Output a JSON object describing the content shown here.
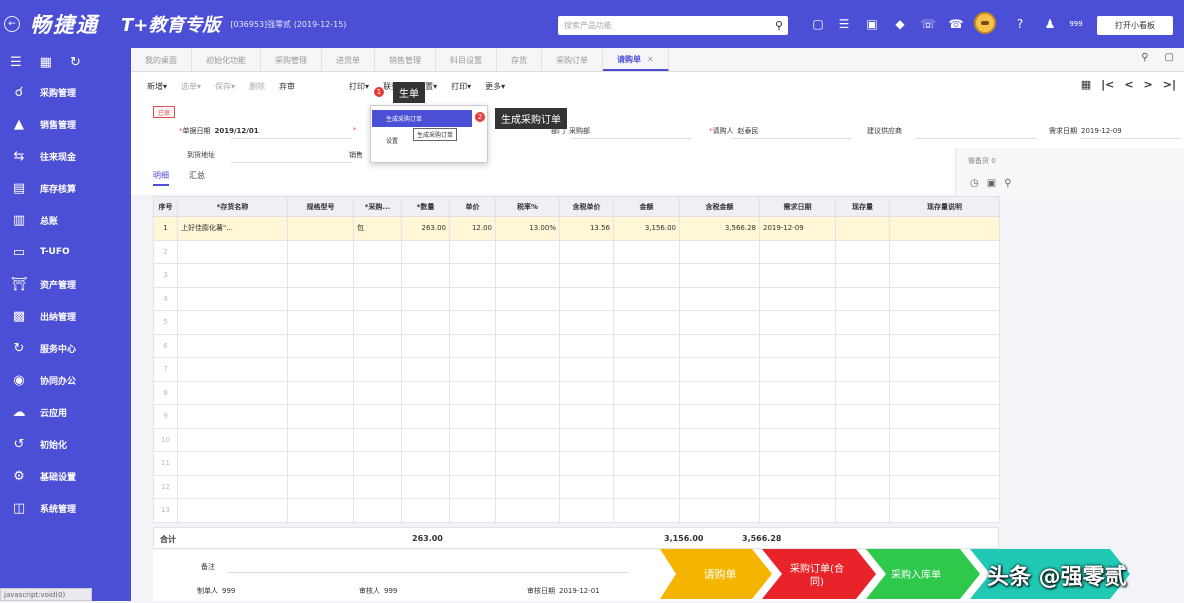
{
  "topbar": {
    "brand": "畅捷通",
    "product": "T+教育专版",
    "account": "[036953]强零贰 (2019-12-15)",
    "search_placeholder": "搜索产品功能",
    "notify_count": "999",
    "open_board": "打开小看板"
  },
  "sidebar": {
    "items": [
      {
        "label": "采购管理",
        "icon": "cart-icon"
      },
      {
        "label": "销售管理",
        "icon": "sales-icon"
      },
      {
        "label": "往来现金",
        "icon": "cash-icon"
      },
      {
        "label": "库存核算",
        "icon": "inventory-icon"
      },
      {
        "label": "总账",
        "icon": "ledger-icon"
      },
      {
        "label": "T-UFO",
        "icon": "report-icon"
      },
      {
        "label": "资产管理",
        "icon": "asset-icon"
      },
      {
        "label": "出纳管理",
        "icon": "cashier-icon"
      },
      {
        "label": "服务中心",
        "icon": "service-icon"
      },
      {
        "label": "协同办公",
        "icon": "office-icon"
      },
      {
        "label": "云应用",
        "icon": "cloud-icon"
      },
      {
        "label": "初始化",
        "icon": "init-icon"
      },
      {
        "label": "基础设置",
        "icon": "settings-icon"
      },
      {
        "label": "系统管理",
        "icon": "system-icon"
      }
    ],
    "status_url": "javascript:void(0)"
  },
  "tabs": [
    {
      "label": "我的桌面"
    },
    {
      "label": "初始化功能"
    },
    {
      "label": "采购管理"
    },
    {
      "label": "进货单"
    },
    {
      "label": "销售管理"
    },
    {
      "label": "科目设置"
    },
    {
      "label": "存货"
    },
    {
      "label": "采购订单"
    },
    {
      "label": "请购单",
      "active": true
    }
  ],
  "toolbar": {
    "items": [
      {
        "label": "新增▾",
        "dim": false
      },
      {
        "label": "选单▾",
        "dim": true
      },
      {
        "label": "保存▾",
        "dim": true
      },
      {
        "label": "删除",
        "dim": true
      },
      {
        "label": "弃审",
        "dim": false
      },
      {
        "label": "生单▾",
        "dim": false
      },
      {
        "label": "打印▾",
        "dim": false
      },
      {
        "label": "联查▾",
        "dim": false
      },
      {
        "label": "设置▾",
        "dim": false
      },
      {
        "label": "打印▾",
        "dim": false
      },
      {
        "label": "更多▾",
        "dim": false
      }
    ]
  },
  "form": {
    "badge": "已审",
    "date_label": "单据日期",
    "date_value": "2019/12/01",
    "dept_label": "部门",
    "dept_value": "采购部",
    "requester_label": "请购人",
    "requester_value": "赵泰民",
    "supplier_label": "建议供应商",
    "need_date_label": "需求日期",
    "need_date_value": "2019-12-09",
    "address_label": "到货地址",
    "sales_label": "销售",
    "detail_tab": "明细",
    "summary_tab": "汇总",
    "side_label": "做备货 0"
  },
  "menu": {
    "callout1": "生单",
    "callout2": "生成采购订单",
    "item1": "生成采购订单",
    "item2": "设置",
    "tooltip": "生成采购订单",
    "step1": "1",
    "step2": "2"
  },
  "table": {
    "headers": [
      "序号",
      "*存货名称",
      "规格型号",
      "*采购...",
      "*数量",
      "单价",
      "税率%",
      "含税单价",
      "金额",
      "含税金额",
      "需求日期",
      "现存量",
      "现存量说明"
    ],
    "rows": [
      [
        "1",
        "上好佳膨化薯\"...",
        "",
        "包",
        "263.00",
        "12.00",
        "13.00%",
        "13.56",
        "3,156.00",
        "3,566.28",
        "2019-12-09",
        "",
        ""
      ],
      [
        "2",
        "",
        "",
        "",
        "",
        "",
        "",
        "",
        "",
        "",
        "",
        "",
        ""
      ],
      [
        "3",
        "",
        "",
        "",
        "",
        "",
        "",
        "",
        "",
        "",
        "",
        "",
        ""
      ],
      [
        "4",
        "",
        "",
        "",
        "",
        "",
        "",
        "",
        "",
        "",
        "",
        "",
        ""
      ],
      [
        "5",
        "",
        "",
        "",
        "",
        "",
        "",
        "",
        "",
        "",
        "",
        "",
        ""
      ],
      [
        "6",
        "",
        "",
        "",
        "",
        "",
        "",
        "",
        "",
        "",
        "",
        "",
        ""
      ],
      [
        "7",
        "",
        "",
        "",
        "",
        "",
        "",
        "",
        "",
        "",
        "",
        "",
        ""
      ],
      [
        "8",
        "",
        "",
        "",
        "",
        "",
        "",
        "",
        "",
        "",
        "",
        "",
        ""
      ],
      [
        "9",
        "",
        "",
        "",
        "",
        "",
        "",
        "",
        "",
        "",
        "",
        "",
        ""
      ],
      [
        "10",
        "",
        "",
        "",
        "",
        "",
        "",
        "",
        "",
        "",
        "",
        "",
        ""
      ],
      [
        "11",
        "",
        "",
        "",
        "",
        "",
        "",
        "",
        "",
        "",
        "",
        "",
        ""
      ],
      [
        "12",
        "",
        "",
        "",
        "",
        "",
        "",
        "",
        "",
        "",
        "",
        "",
        ""
      ],
      [
        "13",
        "",
        "",
        "",
        "",
        "",
        "",
        "",
        "",
        "",
        "",
        "",
        ""
      ]
    ],
    "total_label": "合计",
    "total_qty": "263.00",
    "total_amount": "3,156.00",
    "total_tax_amount": "3,566.28"
  },
  "footer": {
    "note_label": "备注",
    "maker_label": "制单人",
    "maker_value": "999",
    "auditor_label": "审核人",
    "auditor_value": "999",
    "audit_date_label": "审核日期",
    "audit_date_value": "2019-12-01"
  },
  "flow": {
    "steps": [
      "请购单",
      "采购订单(合同)",
      "采购入库单",
      ""
    ],
    "colors": [
      "#f4b400",
      "#e8232a",
      "#2ec84a",
      "#21c9b5"
    ],
    "watermark": "头条 @强零贰"
  }
}
